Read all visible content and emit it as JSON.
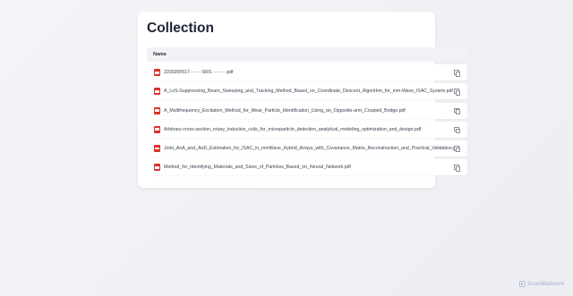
{
  "page": {
    "title": "Collection"
  },
  "table": {
    "header": {
      "name": "Name"
    },
    "rows": [
      {
        "file_name": "2200200517-···-···SRS······-··.pdf",
        "icon": "pdf-icon",
        "action_icon": "copy-icon"
      },
      {
        "file_name": "A_LoS-Suppressing_Beam_Sweeping_and_Tracking_Method_Based_on_Coordinate_Descent_Algorithm_for_mm-Wave_ISAC_System.pdf",
        "icon": "pdf-icon",
        "action_icon": "copy-icon"
      },
      {
        "file_name": "A_Multifrequency_Excitation_Method_for_Wear_Particle_Identification_Using_an_Opposite-arm_Coupled_Bridge.pdf",
        "icon": "pdf-icon",
        "action_icon": "copy-icon"
      },
      {
        "file_name": "Arbitrary-cross-section_rotary_inductive_coils_for_microparticle_detection_analytical_modeling_optimization_and_design.pdf",
        "icon": "pdf-icon",
        "action_icon": "copy-icon"
      },
      {
        "file_name": "Joint_AoA_and_AoD_Estimation_for_ISAC_in_mmWave_Hybrid_Arrays_with_Covariance_Matrix_Reconstruction_and_Practical_Validation.pdf",
        "icon": "pdf-icon",
        "action_icon": "copy-icon"
      },
      {
        "file_name": "Method_for_Identifying_Materials_and_Sizes_of_Particles_Based_on_Neural_Network.pdf",
        "icon": "pdf-icon",
        "action_icon": "copy-icon"
      }
    ]
  },
  "watermark": {
    "text": "ScanMalware",
    "icon": "scanmalware-logo-icon"
  },
  "colors": {
    "pdf_icon": "#d9302c",
    "title": "#1f2433",
    "background": "#eef0f4"
  }
}
